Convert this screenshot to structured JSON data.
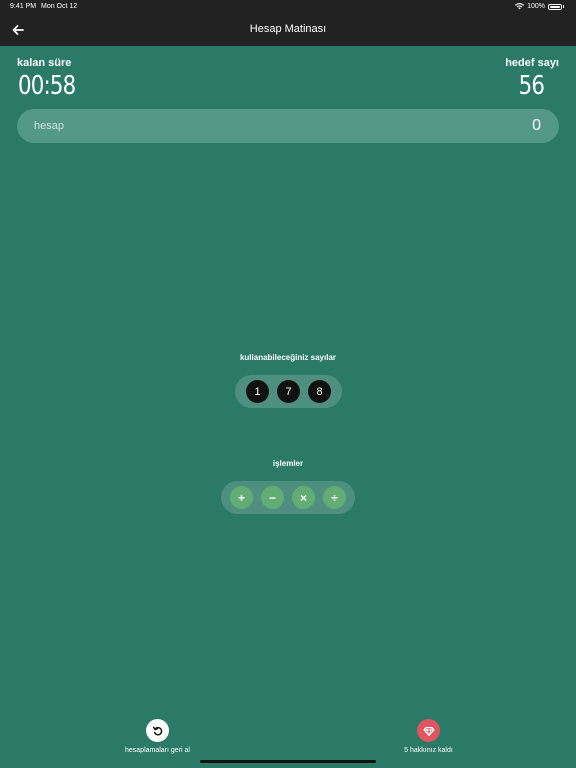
{
  "status_bar": {
    "time": "9:41 PM",
    "date": "Mon Oct 12",
    "battery": "100%"
  },
  "nav": {
    "title": "Hesap Matinası",
    "back_icon": "arrow-left-icon"
  },
  "timer": {
    "label": "kalan süre",
    "value": "00:58"
  },
  "target": {
    "label": "hedef sayı",
    "value": "56"
  },
  "calc": {
    "placeholder": "hesap",
    "value": "0"
  },
  "numbers": {
    "label": "kullanabileceğiniz sayılar",
    "items": [
      "1",
      "7",
      "8"
    ]
  },
  "operations": {
    "label": "işlemler",
    "items": [
      "+",
      "−",
      "×",
      "÷"
    ]
  },
  "actions": {
    "undo": {
      "label": "hesaplamaları geri al",
      "icon": "undo-icon"
    },
    "lives": {
      "label": "5 hakkınız kaldı",
      "icon": "diamond-icon",
      "color": "#e0555f"
    }
  },
  "colors": {
    "background": "#2a7a67",
    "bar": "#222222",
    "op_green": "#61ad73",
    "number_black": "#111111"
  }
}
